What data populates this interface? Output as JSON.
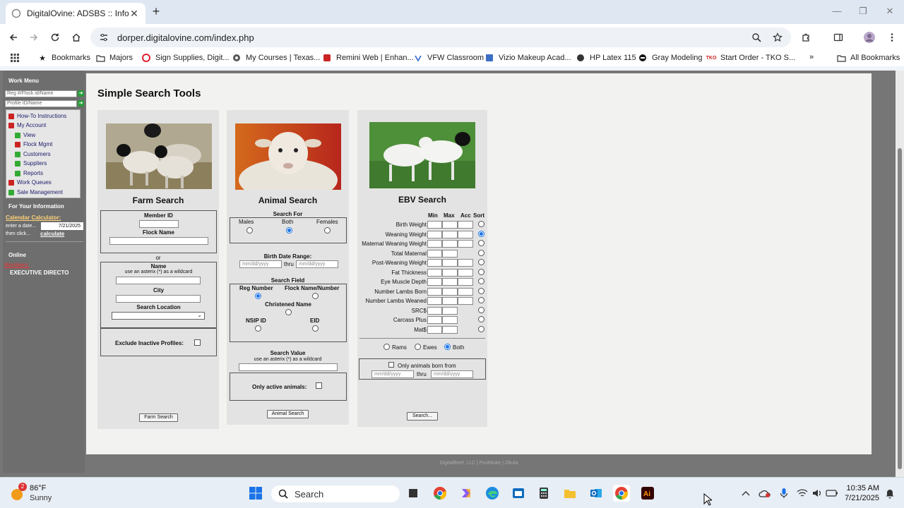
{
  "browser": {
    "tab_title": "DigitalOvine: ADSBS :: Informat",
    "url": "dorper.digitalovine.com/index.php"
  },
  "bookmarks": [
    {
      "label": "Bookmarks",
      "icon": "star-icon"
    },
    {
      "label": "Majors",
      "icon": "folder-icon"
    },
    {
      "label": "Sign Supplies, Digit...",
      "icon": "site-icon"
    },
    {
      "label": "My Courses | Texas...",
      "icon": "site-icon"
    },
    {
      "label": "Remini Web | Enhan...",
      "icon": "site-icon"
    },
    {
      "label": "VFW Classroom",
      "icon": "site-icon"
    },
    {
      "label": "Vizio Makeup Acad...",
      "icon": "site-icon"
    },
    {
      "label": "HP Latex 115",
      "icon": "site-icon"
    },
    {
      "label": "Gray Modeling",
      "icon": "site-icon"
    },
    {
      "label": "Start Order - TKO S...",
      "icon": "site-icon"
    }
  ],
  "all_bookmarks": "All Bookmarks",
  "sidebar": {
    "work_menu": "Work Menu",
    "reg_placeholder": "Reg #/Flock id/Name",
    "profile_placeholder": "Profile ID/Name",
    "items": [
      {
        "label": "How-To Instructions",
        "color": "#cc2222"
      },
      {
        "label": "My Account",
        "color": "#cc2222"
      },
      {
        "label": "View",
        "color": "#33aa33"
      },
      {
        "label": "Flock Mgmt",
        "color": "#cc2222"
      },
      {
        "label": "Customers",
        "color": "#33aa33"
      },
      {
        "label": "Suppliers",
        "color": "#33aa33"
      },
      {
        "label": "Reports",
        "color": "#33aa33"
      },
      {
        "label": "Work Queues",
        "color": "#cc2222"
      },
      {
        "label": "Sale Management",
        "color": "#33aa33"
      }
    ],
    "for_info": "For Your Information",
    "calendar_calc": "Calendar Calculator:",
    "enter_date": "enter a date...",
    "date_value": "7/21/2025",
    "then_click": "then click...",
    "calculate": "calculate",
    "online": "Online",
    "members": "Members:",
    "member_name": "EXECUTIVE DIRECTO"
  },
  "main": {
    "title": "Simple Search Tools",
    "farm": {
      "heading": "Farm Search",
      "member_id": "Member ID",
      "flock_name": "Flock Name",
      "or": "or",
      "name": "Name",
      "wildcard": "use an asterix (*) as a wildcard",
      "city": "City",
      "search_location": "Search Location",
      "exclude_inactive": "Exclude Inactive Profiles:",
      "button": "Farm Search"
    },
    "animal": {
      "heading": "Animal Search",
      "search_for": "Search For",
      "males": "Males",
      "both": "Both",
      "females": "Females",
      "birth_date_range": "Birth Date Range:",
      "date_placeholder": "mm/dd/yyyy",
      "thru": "thru",
      "search_field": "Search Field",
      "reg_number": "Reg Number",
      "flock_name_number": "Flock Name/Number",
      "christened_name": "Christened Name",
      "nsip_id": "NSIP ID",
      "eid": "EID",
      "search_value": "Search Value",
      "wildcard": "use an asterix (*) as a wildcard",
      "only_active": "Only active animals:",
      "button": "Animal Search"
    },
    "ebv": {
      "heading": "EBV Search",
      "col_min": "Min",
      "col_max": "Max",
      "col_acc": "Acc",
      "col_sort": "Sort",
      "rows": [
        {
          "name": "Birth Weight",
          "acc": true,
          "sorted": false
        },
        {
          "name": "Weaning Weight",
          "acc": true,
          "sorted": true
        },
        {
          "name": "Maternal Weaning Weight",
          "acc": true,
          "sorted": false
        },
        {
          "name": "Total Maternal",
          "acc": false,
          "sorted": false
        },
        {
          "name": "Post-Weaning Weight",
          "acc": true,
          "sorted": false
        },
        {
          "name": "Fat Thickness",
          "acc": true,
          "sorted": false
        },
        {
          "name": "Eye Muscle Depth",
          "acc": true,
          "sorted": false
        },
        {
          "name": "Number Lambs Born",
          "acc": true,
          "sorted": false
        },
        {
          "name": "Number Lambs Weaned",
          "acc": true,
          "sorted": false
        },
        {
          "name": "SRC$",
          "acc": false,
          "sorted": false
        },
        {
          "name": "Carcass Plus",
          "acc": false,
          "sorted": false
        },
        {
          "name": "Mat$",
          "acc": false,
          "sorted": false
        }
      ],
      "rams": "Rams",
      "ewes": "Ewes",
      "both": "Both",
      "only_born_from": "Only animals born from",
      "date_placeholder": "mm/dd/yyyy",
      "thru": "thru",
      "button": "Search..."
    }
  },
  "footer": "DigitalBeef, LLC | PostNuke | Zikula",
  "taskbar": {
    "temp": "86°F",
    "weather": "Sunny",
    "weather_badge": "2",
    "search": "Search",
    "time": "10:35 AM",
    "date": "7/21/2025"
  }
}
